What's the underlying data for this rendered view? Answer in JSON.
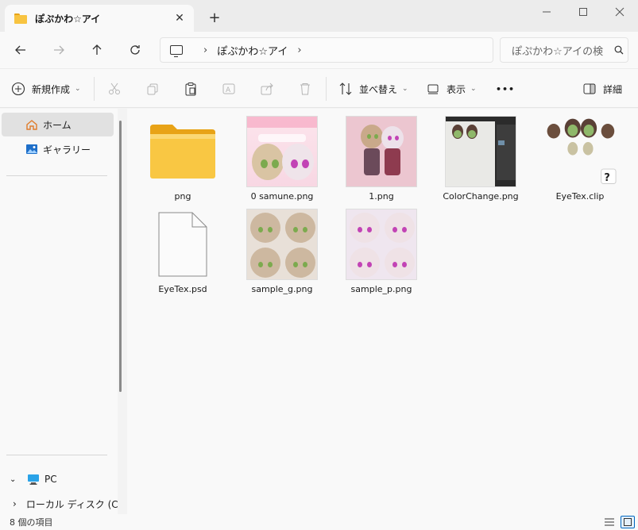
{
  "window": {
    "tab_title": "ぽぷかわ☆アイ",
    "tab_close": "✕",
    "new_tab": "+",
    "minimize": "—",
    "maximize": "☐",
    "close": "✕"
  },
  "nav": {
    "back": "←",
    "forward": "→",
    "up": "↑",
    "refresh": "↻",
    "chevron": "›",
    "breadcrumb": [
      "ぽぷかわ☆アイ"
    ],
    "search_placeholder": "ぽぷかわ☆アイの検"
  },
  "toolbar": {
    "new_label": "新規作成",
    "sort_label": "並べ替え",
    "view_label": "表示",
    "more_label": "•••",
    "details_label": "詳細"
  },
  "sidebar": {
    "home": "ホーム",
    "gallery": "ギャラリー",
    "pc": "PC",
    "local_disk": "ローカル ディスク (C"
  },
  "files": [
    {
      "name": "png",
      "kind": "folder"
    },
    {
      "name": "0 samune.png",
      "kind": "image"
    },
    {
      "name": "1.png",
      "kind": "image"
    },
    {
      "name": "ColorChange.png",
      "kind": "image"
    },
    {
      "name": "EyeTex.clip",
      "kind": "clip"
    },
    {
      "name": "EyeTex.psd",
      "kind": "generic"
    },
    {
      "name": "sample_g.png",
      "kind": "image"
    },
    {
      "name": "sample_p.png",
      "kind": "image"
    }
  ],
  "status": {
    "item_count": "8 個の項目"
  },
  "colors": {
    "accent": "#0067c0",
    "folder": "#f8c441",
    "selection": "#e1e1e1"
  }
}
